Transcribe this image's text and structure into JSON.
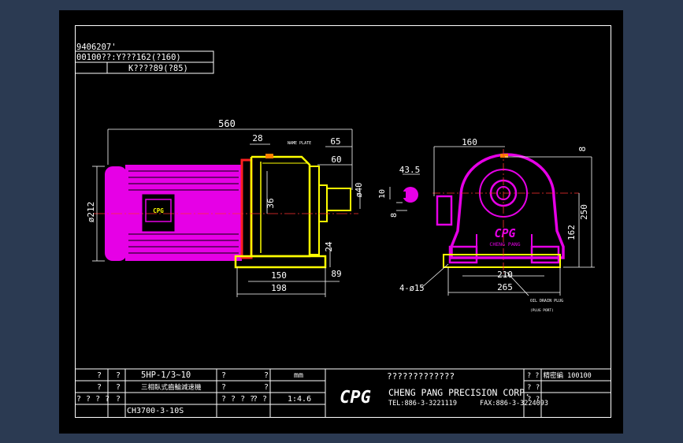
{
  "header_table": {
    "row1": "9406207'",
    "row2": "00100??:Y???162(?160)",
    "row3": "K????89(?85)"
  },
  "side_view": {
    "overall_length": "560",
    "dim_28": "28",
    "dim_65": "65",
    "dim_60": "60",
    "shaft_diameter": "ø40",
    "motor_diameter": "ø212",
    "dim_36": "36",
    "dim_24": "24",
    "dim_150": "150",
    "dim_89": "89",
    "dim_198": "198",
    "note_top": "NAME PLATE"
  },
  "shaft_detail": {
    "dim_43_5": "43.5",
    "dim_10": "10",
    "dim_8": "8"
  },
  "front_view": {
    "dim_160": "160",
    "dim_8": "8",
    "dim_250": "250",
    "dim_162": "162",
    "dim_210": "210",
    "dim_265": "265",
    "holes": "4-ø15",
    "note_bottom": "OIL DRAIN PLUG",
    "note_bottom_sub": "(PLUG PORT)"
  },
  "logo": {
    "text": "CPG",
    "sub_text": "CHENG PANG"
  },
  "title_block": {
    "c1r1": "?",
    "c2r1": "?",
    "model": "5HP-1/3~10",
    "c4r1": "?",
    "c5r1": "?",
    "unit": "mm",
    "c1r2": "?",
    "c2r2": "?",
    "description": "三相臥式齒輪減速機",
    "c4r2": "?",
    "c5r2": "?",
    "scale": "1:4.6",
    "c1r3": "? ? ? ?",
    "c2r3": "?",
    "part_no": "CH3700-3-10S",
    "c4r3": "? ? ? ?",
    "c5r3": "? ?",
    "company_native": "?????????????",
    "company": "CHENG PANG PRECISION CORP.",
    "tel": "TEL:886-3-3221119",
    "fax": "FAX:886-3-3224093",
    "right_top": "?  ?  精密編 100100",
    "right_mid": "?  ?",
    "right_bot": "?  ?"
  }
}
